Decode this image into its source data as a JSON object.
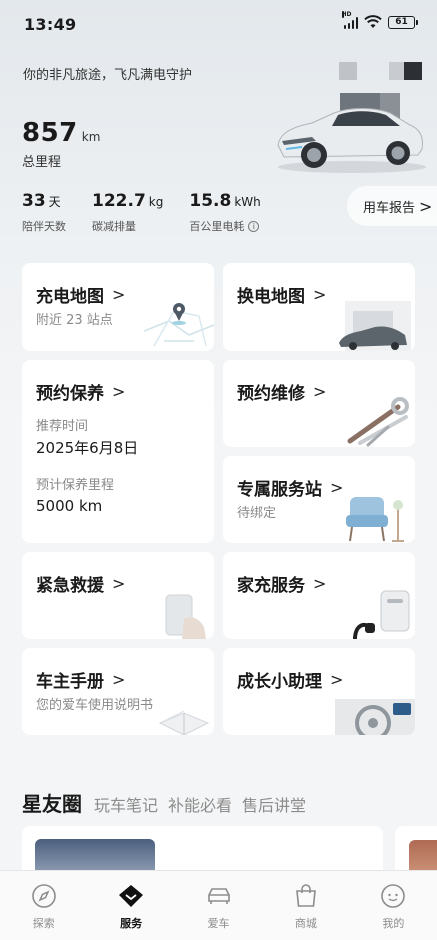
{
  "status_bar": {
    "time": "13:49",
    "network": "HD",
    "battery": "61"
  },
  "hero": {
    "slogan": "你的非凡旅途，飞凡满电守护",
    "odometer_value": "857",
    "odometer_unit": "km",
    "odometer_label": "总里程"
  },
  "stats": [
    {
      "value": "33",
      "unit": "天",
      "label": "陪伴天数"
    },
    {
      "value": "122.7",
      "unit": "kg",
      "label": "碳减排量"
    },
    {
      "value": "15.8",
      "unit": "kWh",
      "label": "百公里电耗"
    }
  ],
  "report_link": "用车报告",
  "cards": {
    "charging_map": {
      "title": "充电地图",
      "subtitle": "附近 23 站点"
    },
    "swap_map": {
      "title": "换电地图"
    },
    "maintenance": {
      "title": "预约保养",
      "recommended_time_label": "推荐时间",
      "recommended_time": "2025年6月8日",
      "mileage_label": "预计保养里程",
      "mileage": "5000 km"
    },
    "repair": {
      "title": "预约维修"
    },
    "service_station": {
      "title": "专属服务站",
      "subtitle": "待绑定"
    },
    "rescue": {
      "title": "紧急救援"
    },
    "home_charging": {
      "title": "家充服务"
    },
    "manual": {
      "title": "车主手册",
      "subtitle": "您的爱车使用说明书"
    },
    "assistant": {
      "title": "成长小助理"
    }
  },
  "community": {
    "title": "星友圈",
    "tabs": [
      "玩车笔记",
      "补能必看",
      "售后讲堂"
    ]
  },
  "tabbar": [
    {
      "label": "探索",
      "icon": "compass-icon",
      "active": false
    },
    {
      "label": "服务",
      "icon": "diamond-icon",
      "active": true
    },
    {
      "label": "爱车",
      "icon": "car-icon",
      "active": false
    },
    {
      "label": "商城",
      "icon": "shopping-bag-icon",
      "active": false
    },
    {
      "label": "我的",
      "icon": "profile-icon",
      "active": false
    }
  ],
  "chevron": ">",
  "info_glyph": "i"
}
